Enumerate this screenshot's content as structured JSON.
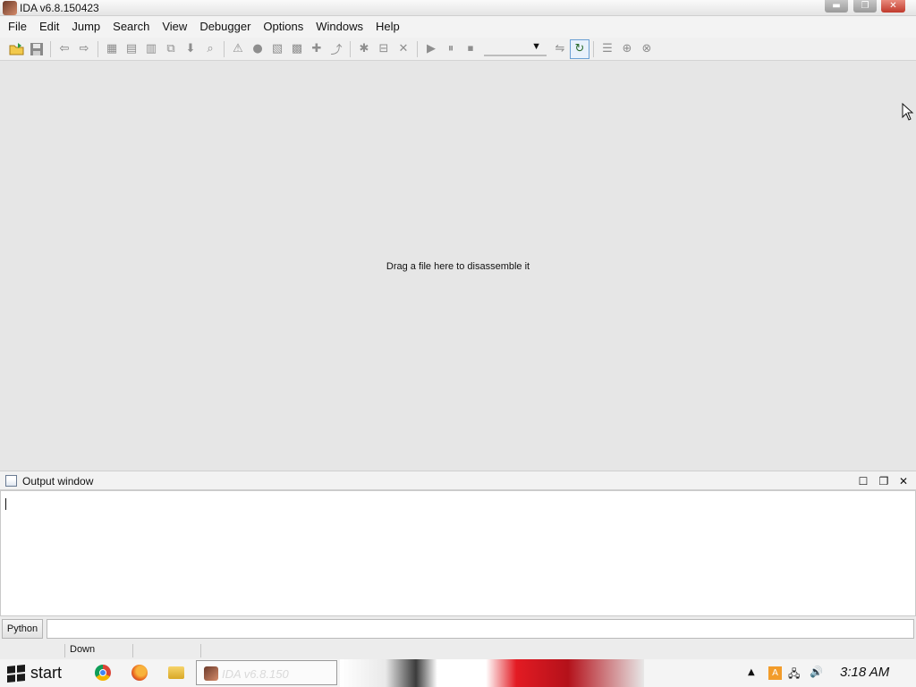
{
  "window": {
    "title": "IDA v6.8.150423",
    "minimize_glyph": "▬",
    "maximize_glyph": "❐",
    "close_glyph": "✕"
  },
  "menubar": {
    "items": [
      "File",
      "Edit",
      "Jump",
      "Search",
      "View",
      "Debugger",
      "Options",
      "Windows",
      "Help"
    ]
  },
  "toolbar": {
    "groups": [
      [
        "open-file-icon",
        "save-icon"
      ],
      [
        "back-arrow-icon",
        "forward-arrow-icon"
      ],
      [
        "make-code-icon",
        "make-text-icon",
        "make-data-icon",
        "make-array-icon",
        "down-arrow-icon",
        "search-binary-icon"
      ],
      [
        "warning-icon",
        "circle-icon",
        "segment-icon",
        "structure-icon",
        "add-text-icon",
        "add-xref-icon"
      ],
      [
        "plugin-icon",
        "folder-open-icon",
        "close-x-icon"
      ],
      [
        "play-icon",
        "pause-icon",
        "stop-icon"
      ],
      [
        "attach-process-icon",
        "run-to-cursor-icon"
      ],
      [
        "breakpoint-list-icon",
        "add-breakpoint-icon",
        "delete-breakpoint-icon"
      ]
    ],
    "debugger_dropdown_value": ""
  },
  "main": {
    "drop_hint": "Drag a file here to disassemble it"
  },
  "output_window": {
    "title": "Output window",
    "maximize_glyph": "☐",
    "restore_glyph": "❐",
    "close_glyph": "✕",
    "content": ""
  },
  "python_bar": {
    "button_label": "Python",
    "input_value": ""
  },
  "statusbar": {
    "direction": "Down"
  },
  "taskbar": {
    "start_label": "start",
    "pinned": [
      "chrome-icon",
      "firefox-icon",
      "folder-icon"
    ],
    "active_task_label": "IDA v6.8.150",
    "tray_a_label": "A",
    "clock": "3:18 AM"
  },
  "colors": {
    "window_bg": "#e6e6e6",
    "menubar_bg": "#f3f3f3",
    "close_button": "#c0392b",
    "taskbar_accent_red": "#e31b23"
  }
}
